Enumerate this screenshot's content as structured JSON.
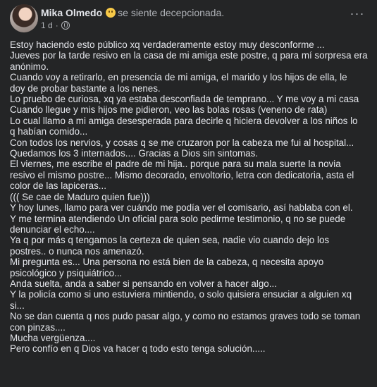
{
  "post": {
    "author": "Mika Olmedo",
    "feeling_emoji": "disappointed-face-icon",
    "feeling": "se siente decepcionada.",
    "time": "1 d",
    "separator": "·",
    "privacy_icon": "globe-icon",
    "more_icon": "···",
    "lines": [
      "Estoy haciendo esto público xq verdaderamente estoy muy desconforme ...",
      "Jueves por la tarde resivo en la casa de mi amiga este postre, q para mí sorpresa era",
      "anónimo.",
      "Cuando voy a retirarlo, en presencia de mi amiga, el marido y los hijos de ella, le",
      "doy de probar bastante a los nenes.",
      "Lo pruebo de curiosa, xq ya estaba desconfiada de temprano... Y me voy a mi casa",
      "Cuando llegue y mis hijos me pidieron, veo las bolas rosas (veneno de rata)",
      "Lo cual llamo a mi amiga desesperada para decirle q hiciera devolver a los niños lo",
      "q habían comido...",
      "Con todos los nervios, y cosas q se me cruzaron por la cabeza me fui al hospital...",
      "Quedamos los 3 internados.... Gracias a Dios sin sintomas.",
      "El viernes, me escribe el padre de mi hija.. porque para  su mala suerte la novia",
      "resivo el mismo postre... Mismo decorado, envoltorio, letra con dedicatoria, asta el",
      "color de las lapiceras...",
      "((( Se cae de Maduro quien fue)))",
      "Y hoy lunes, llamo para ver cuándo me podía ver el comisario, así hablaba con el.",
      "Y me termina atendiendo Un oficial para solo pedirme testimonio, q no se puede",
      "denunciar el echo....",
      "Ya q por más q tengamos la certeza de quien sea, nadie vio cuando dejo los",
      "postres.. o nunca nos amenazó.",
      "Mi pregunta es... Una persona no está bien de la cabeza, q necesita apoyo",
      "psicológico y psiquiátrico...",
      "Anda suelta, anda a saber si pensando en volver a hacer algo...",
      "Y la policía como si uno estuviera mintiendo, o solo quisiera ensuciar a alguien xq",
      "si...",
      "No se dan cuenta q nos pudo pasar algo, y como no estamos graves todo se toman",
      "con pinzas....",
      "Mucha vergüenza....",
      "Pero confío en q Dios va hacer q todo esto tenga solución....."
    ]
  }
}
